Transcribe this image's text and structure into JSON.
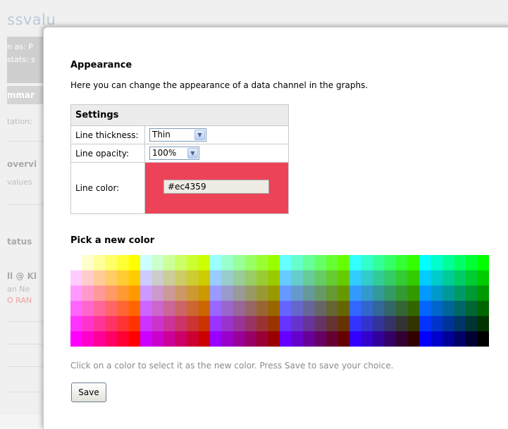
{
  "background": {
    "title_fragment": "ssvalu",
    "fragments": [
      "n as: P",
      "stats: s",
      "mmar",
      "tation:",
      "overvi",
      "values",
      "tatus",
      "ll @ Kl",
      "an Ne",
      "O RAN"
    ]
  },
  "dialog": {
    "appearance_heading": "Appearance",
    "appearance_desc": "Here you can change the appearance of a data channel in the graphs.",
    "settings": {
      "header": "Settings",
      "thickness_label": "Line thickness:",
      "thickness_value": "Thin",
      "opacity_label": "Line opacity:",
      "opacity_value": "100%",
      "color_label": "Line color:",
      "color_value": "#ec4359"
    },
    "pick_heading": "Pick a new color",
    "hint": "Click on a color to select it as the new color. Press Save to save your choice.",
    "save_label": "Save"
  },
  "colors": {
    "selected": "#ec4359",
    "header_bg": "#ececec"
  },
  "palette": {
    "block_r": [
      "ff",
      "cc",
      "99",
      "66",
      "33",
      "00"
    ],
    "block_b": [
      "ff",
      "cc",
      "99",
      "66",
      "33",
      "00"
    ],
    "block_g": [
      "ff",
      "cc",
      "99",
      "66",
      "33",
      "00"
    ]
  }
}
